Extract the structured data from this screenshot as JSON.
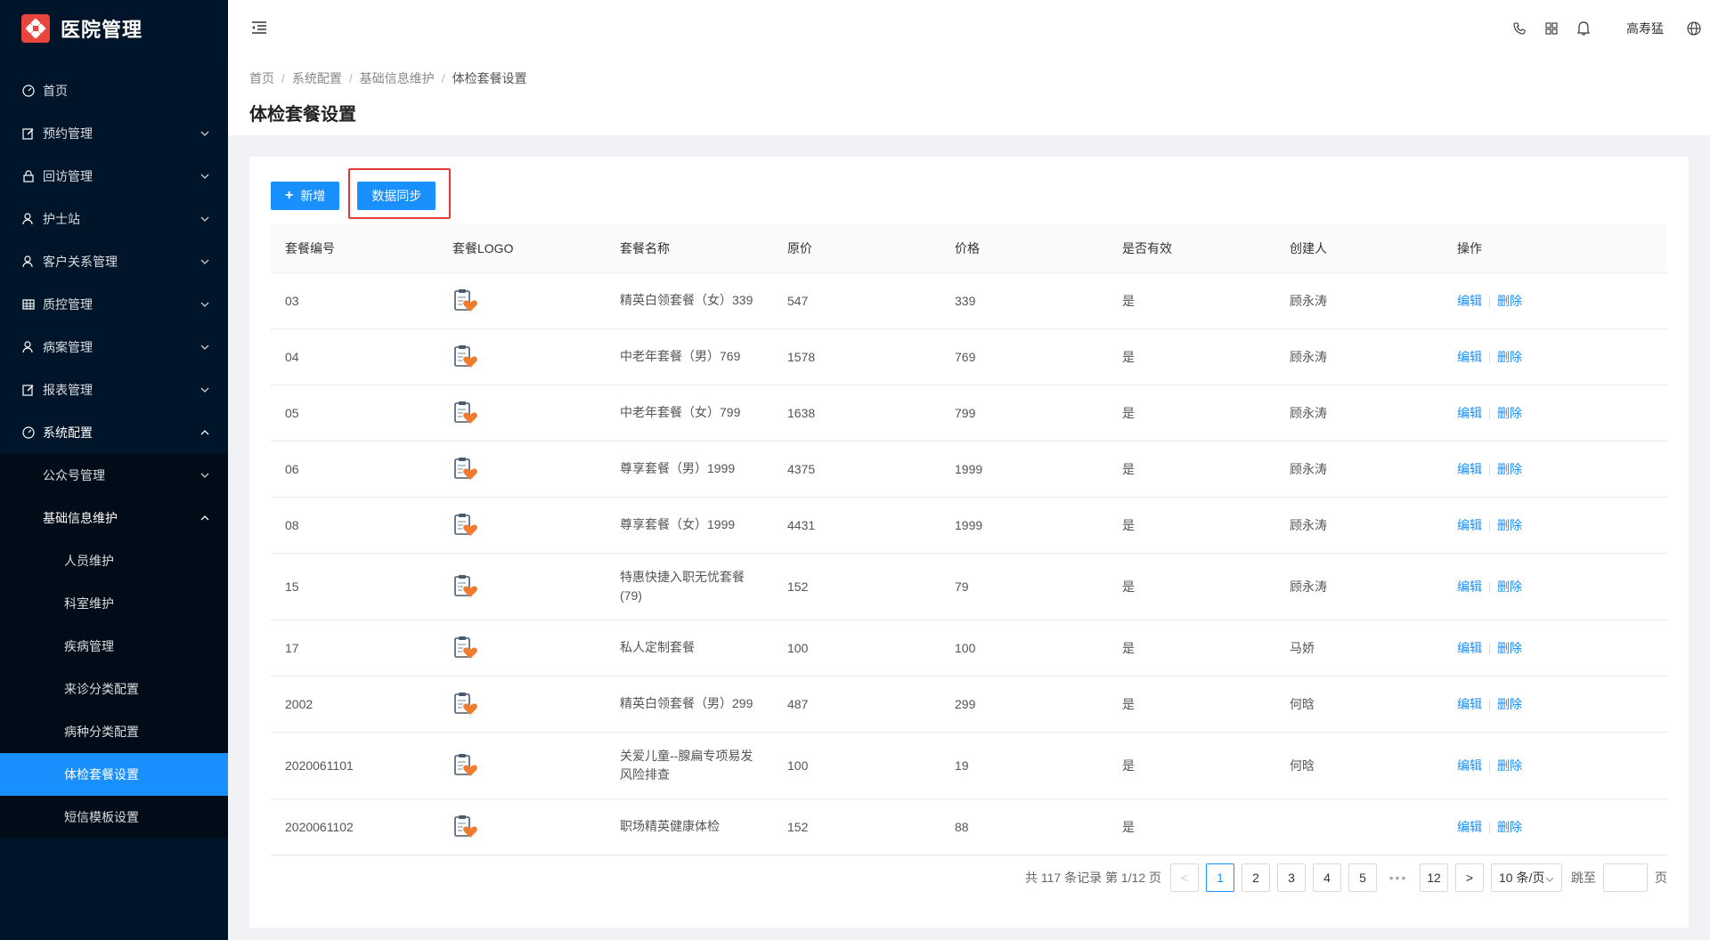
{
  "app": {
    "title": "医院管理"
  },
  "sidebar": {
    "items": [
      {
        "label": "首页",
        "icon": "dashboard-icon"
      },
      {
        "label": "预约管理",
        "icon": "edit-icon"
      },
      {
        "label": "回访管理",
        "icon": "lock-icon"
      },
      {
        "label": "护士站",
        "icon": "user-icon"
      },
      {
        "label": "客户关系管理",
        "icon": "user-icon"
      },
      {
        "label": "质控管理",
        "icon": "table-icon"
      },
      {
        "label": "病案管理",
        "icon": "user-icon"
      },
      {
        "label": "报表管理",
        "icon": "edit-icon"
      },
      {
        "label": "系统配置",
        "icon": "dashboard-icon"
      }
    ],
    "system_children": [
      {
        "label": "公众号管理"
      },
      {
        "label": "基础信息维护"
      }
    ],
    "basic_children": [
      {
        "label": "人员维护"
      },
      {
        "label": "科室维护"
      },
      {
        "label": "疾病管理"
      },
      {
        "label": "来诊分类配置"
      },
      {
        "label": "病种分类配置"
      },
      {
        "label": "体检套餐设置"
      },
      {
        "label": "短信模板设置"
      }
    ]
  },
  "header": {
    "user_name": "高寿猛",
    "icons": [
      "phone-icon",
      "grid-icon",
      "bell-icon",
      "globe-icon"
    ]
  },
  "breadcrumb": [
    "首页",
    "系统配置",
    "基础信息维护",
    "体检套餐设置"
  ],
  "page_title": "体检套餐设置",
  "toolbar": {
    "add_label": "新增",
    "sync_label": "数据同步"
  },
  "table": {
    "columns": [
      "套餐编号",
      "套餐LOGO",
      "套餐名称",
      "原价",
      "价格",
      "是否有效",
      "创建人",
      "操作"
    ],
    "edit_label": "编辑",
    "delete_label": "删除",
    "rows": [
      {
        "code": "03",
        "name": "精英白领套餐（女）339",
        "original": "547",
        "price": "339",
        "valid": "是",
        "creator": "顾永涛"
      },
      {
        "code": "04",
        "name": "中老年套餐（男）769",
        "original": "1578",
        "price": "769",
        "valid": "是",
        "creator": "顾永涛"
      },
      {
        "code": "05",
        "name": "中老年套餐（女）799",
        "original": "1638",
        "price": "799",
        "valid": "是",
        "creator": "顾永涛"
      },
      {
        "code": "06",
        "name": "尊享套餐（男）1999",
        "original": "4375",
        "price": "1999",
        "valid": "是",
        "creator": "顾永涛"
      },
      {
        "code": "08",
        "name": "尊享套餐（女）1999",
        "original": "4431",
        "price": "1999",
        "valid": "是",
        "creator": "顾永涛"
      },
      {
        "code": "15",
        "name": "特惠快捷入职无忧套餐(79)",
        "original": "152",
        "price": "79",
        "valid": "是",
        "creator": "顾永涛"
      },
      {
        "code": "17",
        "name": "私人定制套餐",
        "original": "100",
        "price": "100",
        "valid": "是",
        "creator": "马娇"
      },
      {
        "code": "2002",
        "name": "精英白领套餐（男）299",
        "original": "487",
        "price": "299",
        "valid": "是",
        "creator": "何晗"
      },
      {
        "code": "2020061101",
        "name": "关爱儿童--腺扁专项易发风险排查",
        "original": "100",
        "price": "19",
        "valid": "是",
        "creator": "何晗"
      },
      {
        "code": "2020061102",
        "name": "职场精英健康体检",
        "original": "152",
        "price": "88",
        "valid": "是",
        "creator": ""
      }
    ]
  },
  "pagination": {
    "total_text": "共 117 条记录 第 1/12 页",
    "prev": "<",
    "next": ">",
    "pages": [
      "1",
      "2",
      "3",
      "4",
      "5"
    ],
    "ellipsis": "•••",
    "last_page": "12",
    "page_size": "10 条/页",
    "jump_label": "跳至",
    "page_suffix": "页"
  },
  "colors": {
    "primary": "#1890ff",
    "sidebar_bg": "#001529",
    "highlight": "#e53935",
    "logo": "#e8453c"
  }
}
